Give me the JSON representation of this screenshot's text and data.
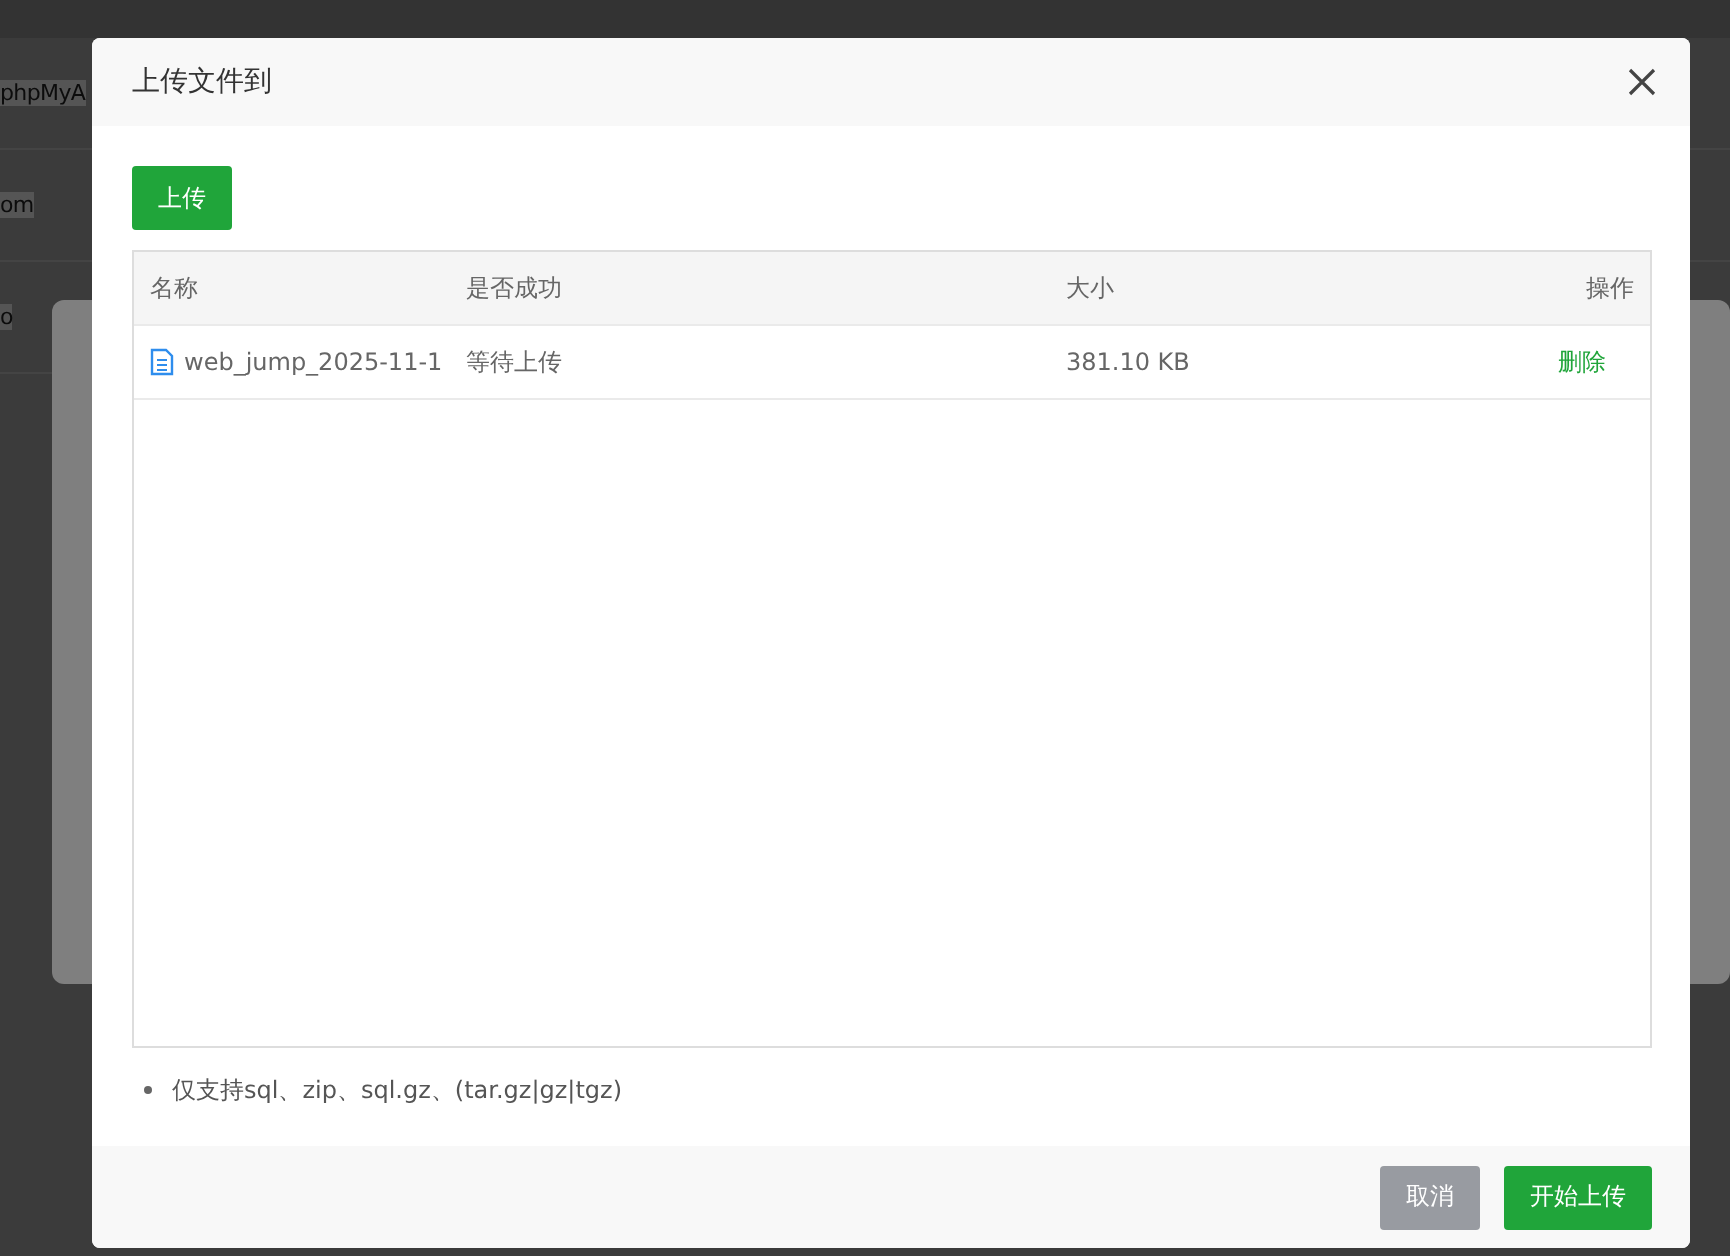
{
  "background": {
    "texts": [
      "phpMyA",
      "om",
      "o"
    ]
  },
  "dialog": {
    "title": "上传文件到",
    "upload_button": "上传",
    "table": {
      "columns": [
        "名称",
        "是否成功",
        "大小",
        "操作"
      ],
      "rows": [
        {
          "name": "web_jump_2025-11-1",
          "status": "等待上传",
          "size": "381.10 KB",
          "action": "删除"
        }
      ]
    },
    "notes": [
      "仅支持sql、zip、sql.gz、(tar.gz|gz|tgz)"
    ],
    "buttons": [
      {
        "label": "取消",
        "kind": "secondary"
      },
      {
        "label": "开始上传",
        "kind": "primary"
      }
    ]
  }
}
